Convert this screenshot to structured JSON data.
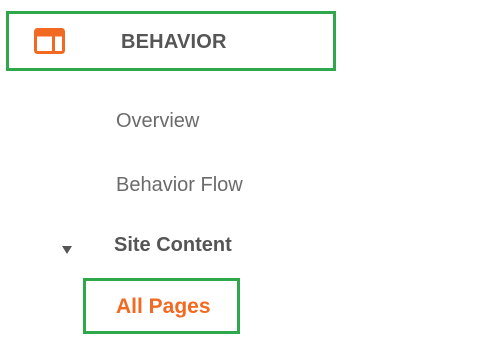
{
  "sidebar": {
    "section": {
      "icon": "behavior-layout-icon",
      "label": "BEHAVIOR",
      "icon_color": "#f26a21"
    },
    "items": [
      {
        "label": "Overview"
      },
      {
        "label": "Behavior Flow"
      }
    ],
    "group": {
      "label": "Site Content",
      "caret_icon": "caret-down-icon",
      "expanded": true,
      "children": [
        {
          "label": "All Pages",
          "selected": true
        }
      ]
    }
  },
  "colors": {
    "highlight_border": "#2ea84a",
    "active_text": "#f26a21",
    "muted_text": "#6b6b6b"
  }
}
